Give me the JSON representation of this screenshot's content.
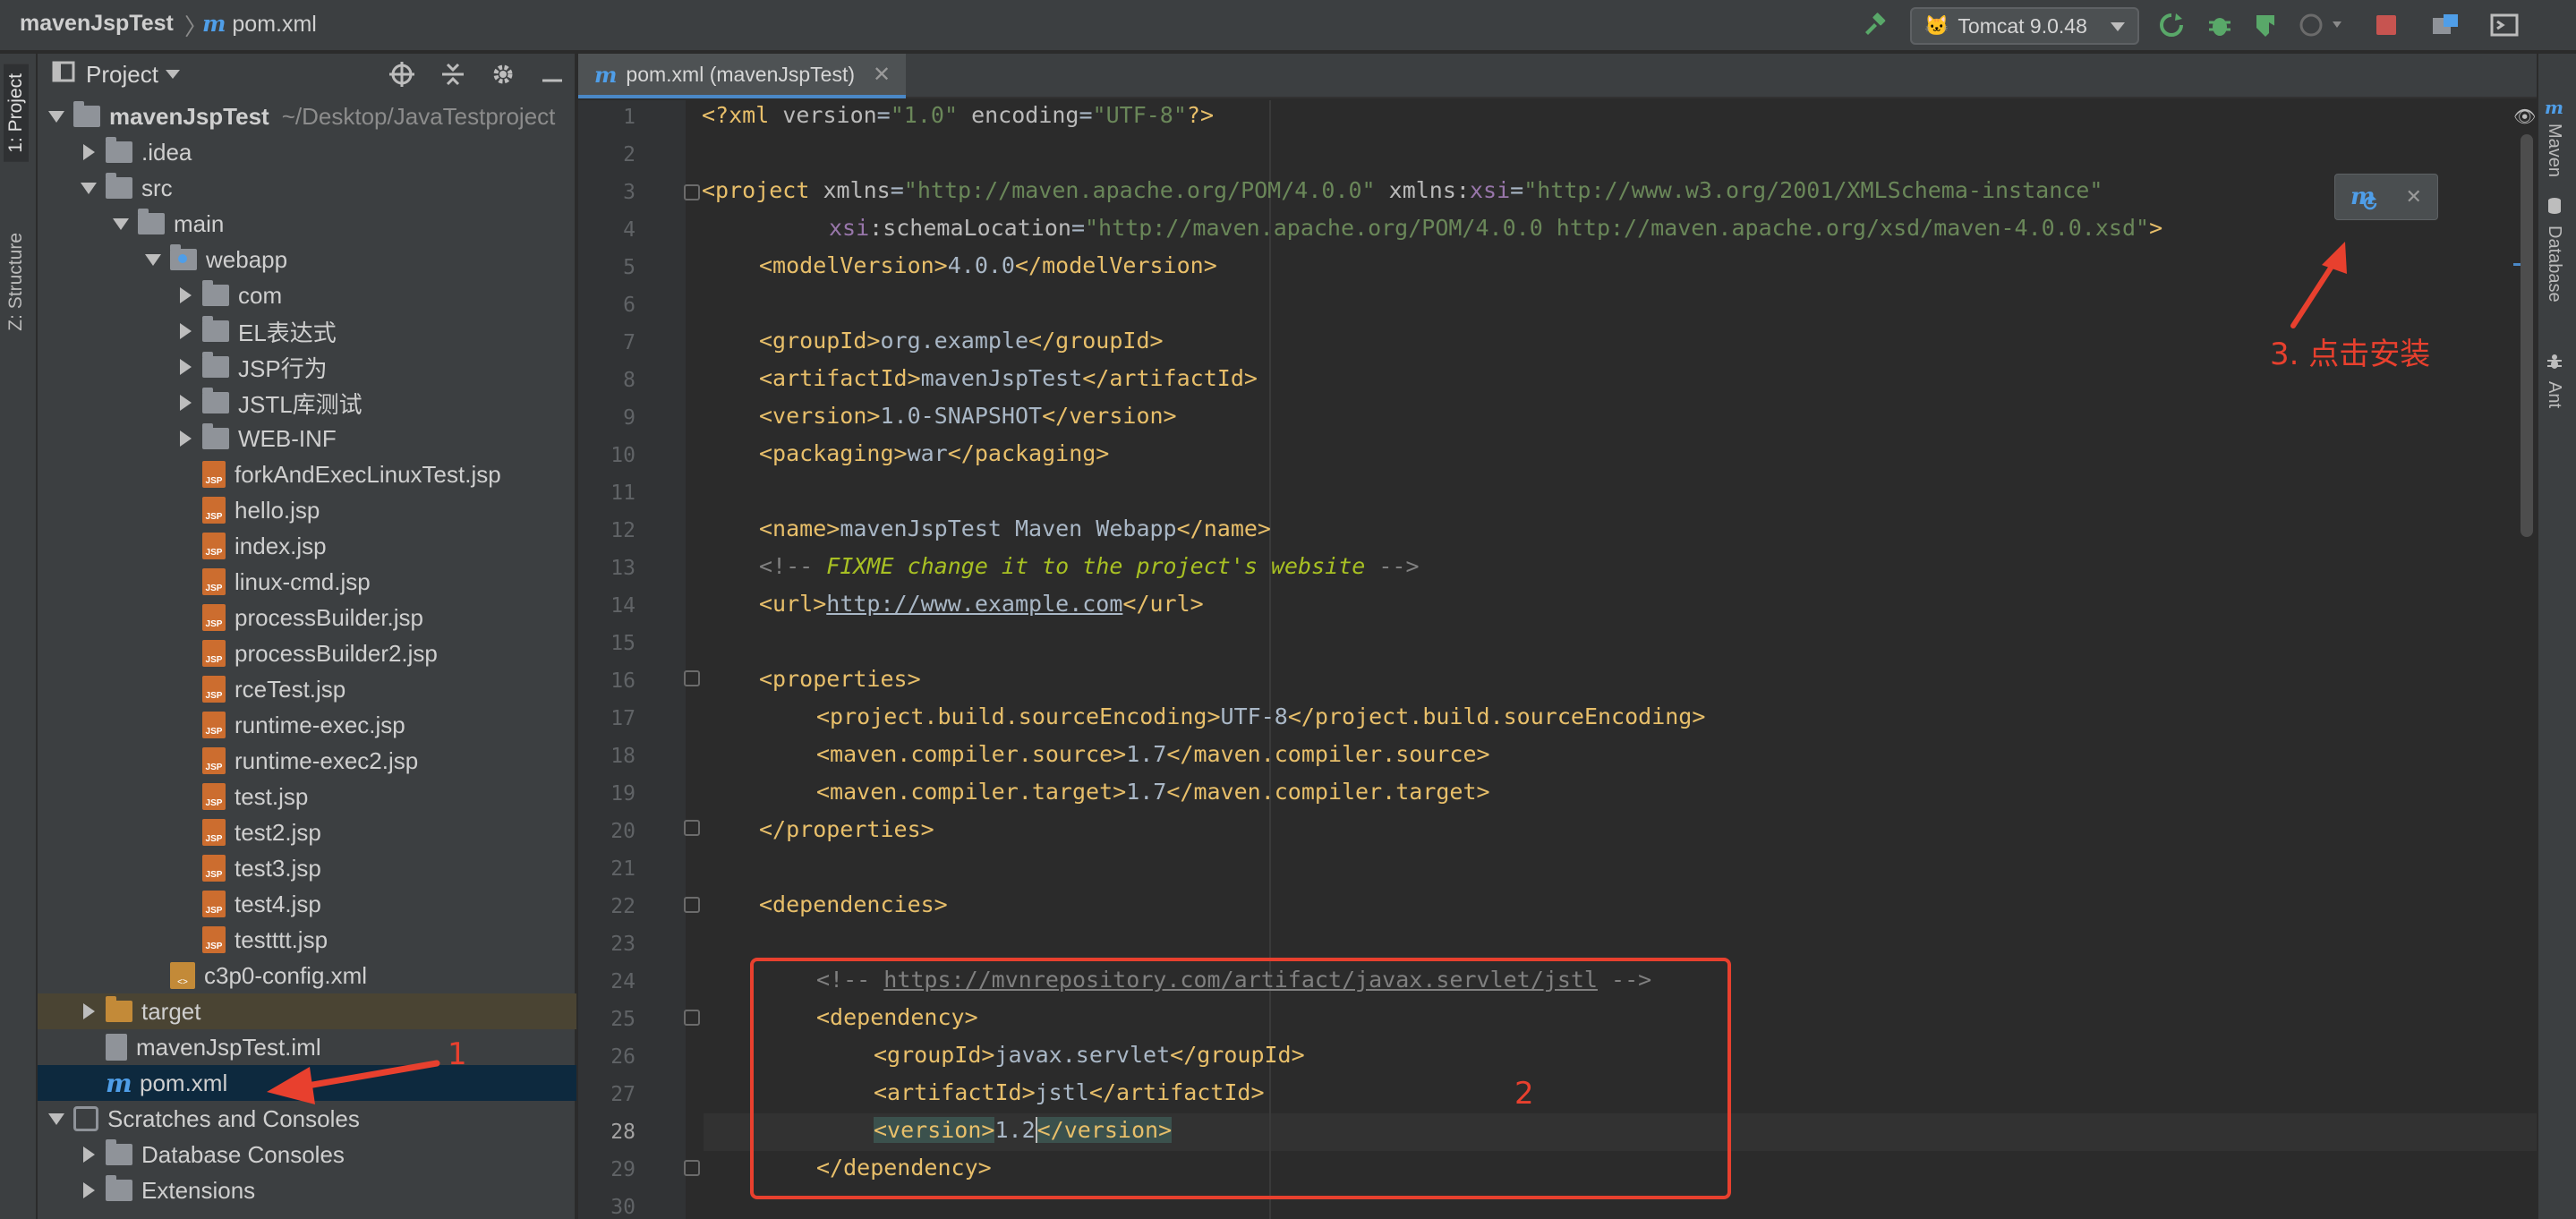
{
  "breadcrumb": {
    "project": "mavenJspTest",
    "file": "pom.xml"
  },
  "toolbar": {
    "run_config": "Tomcat 9.0.48"
  },
  "left_tabs": [
    "1: Project",
    "Z: Structure"
  ],
  "right_tabs": [
    "Maven",
    "Database",
    "Ant"
  ],
  "project_panel": {
    "title": "Project",
    "tree": [
      {
        "label": "mavenJspTest",
        "path": "~/Desktop/JavaTestproject",
        "level": 0,
        "icon": "folder",
        "expanded": true,
        "bold": true
      },
      {
        "label": ".idea",
        "level": 1,
        "icon": "folder",
        "expanded": false
      },
      {
        "label": "src",
        "level": 1,
        "icon": "folder",
        "expanded": true
      },
      {
        "label": "main",
        "level": 2,
        "icon": "folder",
        "expanded": true
      },
      {
        "label": "webapp",
        "level": 3,
        "icon": "web-folder",
        "expanded": true
      },
      {
        "label": "com",
        "level": 4,
        "icon": "folder",
        "expanded": false
      },
      {
        "label": "EL表达式",
        "level": 4,
        "icon": "folder",
        "expanded": false
      },
      {
        "label": "JSP行为",
        "level": 4,
        "icon": "folder",
        "expanded": false
      },
      {
        "label": "JSTL库测试",
        "level": 4,
        "icon": "folder",
        "expanded": false
      },
      {
        "label": "WEB-INF",
        "level": 4,
        "icon": "folder",
        "expanded": false
      },
      {
        "label": "forkAndExecLinuxTest.jsp",
        "level": 4,
        "icon": "jsp"
      },
      {
        "label": "hello.jsp",
        "level": 4,
        "icon": "jsp"
      },
      {
        "label": "index.jsp",
        "level": 4,
        "icon": "jsp"
      },
      {
        "label": "linux-cmd.jsp",
        "level": 4,
        "icon": "jsp"
      },
      {
        "label": "processBuilder.jsp",
        "level": 4,
        "icon": "jsp"
      },
      {
        "label": "processBuilder2.jsp",
        "level": 4,
        "icon": "jsp"
      },
      {
        "label": "rceTest.jsp",
        "level": 4,
        "icon": "jsp"
      },
      {
        "label": "runtime-exec.jsp",
        "level": 4,
        "icon": "jsp"
      },
      {
        "label": "runtime-exec2.jsp",
        "level": 4,
        "icon": "jsp"
      },
      {
        "label": "test.jsp",
        "level": 4,
        "icon": "jsp"
      },
      {
        "label": "test2.jsp",
        "level": 4,
        "icon": "jsp"
      },
      {
        "label": "test3.jsp",
        "level": 4,
        "icon": "jsp"
      },
      {
        "label": "test4.jsp",
        "level": 4,
        "icon": "jsp"
      },
      {
        "label": "testttt.jsp",
        "level": 4,
        "icon": "jsp"
      },
      {
        "label": "c3p0-config.xml",
        "level": 3,
        "icon": "xml"
      },
      {
        "label": "target",
        "level": 1,
        "icon": "orange-folder",
        "expanded": false,
        "highlight": true
      },
      {
        "label": "mavenJspTest.iml",
        "level": 1,
        "icon": "iml"
      },
      {
        "label": "pom.xml",
        "level": 1,
        "icon": "maven",
        "selected": true
      },
      {
        "label": "Scratches and Consoles",
        "level": 0,
        "icon": "scratch",
        "expanded": true
      },
      {
        "label": "Database Consoles",
        "level": 1,
        "icon": "folder",
        "expanded": false
      },
      {
        "label": "Extensions",
        "level": 1,
        "icon": "folder",
        "expanded": false
      }
    ]
  },
  "editor": {
    "tab_label": "pom.xml (mavenJspTest)",
    "current_line": 28,
    "line_numbers": [
      "1",
      "2",
      "3",
      "4",
      "5",
      "6",
      "7",
      "8",
      "9",
      "10",
      "11",
      "12",
      "13",
      "14",
      "15",
      "16",
      "17",
      "18",
      "19",
      "20",
      "21",
      "22",
      "23",
      "24",
      "25",
      "26",
      "27",
      "28",
      "29",
      "30"
    ],
    "code": {
      "l1": {
        "a": "<?xml ",
        "b": "version",
        "c": "=",
        "d": "\"1.0\"",
        "e": " ",
        "f": "encoding",
        "g": "=",
        "h": "\"UTF-8\"",
        "i": "?>"
      },
      "l3": {
        "a": "<project ",
        "b": "xmlns",
        "c": "=",
        "d": "\"http://maven.apache.org/POM/4.0.0\"",
        "e": " ",
        "f": "xmlns",
        "g": ":",
        "h": "xsi",
        "i": "=",
        "j": "\"http://www.w3.org/2001/XMLSchema-instance\""
      },
      "l4": {
        "a": "xsi",
        "b": ":schemaLocation",
        "c": "=",
        "d": "\"http://maven.apache.org/POM/4.0.0 http://maven.apache.org/xsd/maven-4.0.0.xsd\"",
        "e": ">"
      },
      "l5": {
        "a": "<modelVersion>",
        "b": "4.0.0",
        "c": "</modelVersion>"
      },
      "l7": {
        "a": "<groupId>",
        "b": "org.example",
        "c": "</groupId>"
      },
      "l8": {
        "a": "<artifactId>",
        "b": "mavenJspTest",
        "c": "</artifactId>"
      },
      "l9": {
        "a": "<version>",
        "b": "1.0-SNAPSHOT",
        "c": "</version>"
      },
      "l10": {
        "a": "<packaging>",
        "b": "war",
        "c": "</packaging>"
      },
      "l12": {
        "a": "<name>",
        "b": "mavenJspTest Maven Webapp",
        "c": "</name>"
      },
      "l13": {
        "a": "<!-- ",
        "b": "FIXME change it to the project's website",
        "c": " -->"
      },
      "l14": {
        "a": "<url>",
        "b": "http://www.example.com",
        "c": "</url>"
      },
      "l16": {
        "a": "<properties>"
      },
      "l17": {
        "a": "<project.build.sourceEncoding>",
        "b": "UTF-8",
        "c": "</project.build.sourceEncoding>"
      },
      "l18": {
        "a": "<maven.compiler.source>",
        "b": "1.7",
        "c": "</maven.compiler.source>"
      },
      "l19": {
        "a": "<maven.compiler.target>",
        "b": "1.7",
        "c": "</maven.compiler.target>"
      },
      "l20": {
        "a": "</properties>"
      },
      "l22": {
        "a": "<dependencies>"
      },
      "l24": {
        "a": "<!-- ",
        "b": "https://mvnrepository.com/artifact/javax.servlet/jstl",
        "c": " -->"
      },
      "l25": {
        "a": "<dependency>"
      },
      "l26": {
        "a": "<groupId>",
        "b": "javax.servlet",
        "c": "</groupId>"
      },
      "l27": {
        "a": "<artifactId>",
        "b": "jstl",
        "c": "</artifactId>"
      },
      "l28": {
        "a": "<version>",
        "b": "1.2",
        "c": "</version>"
      },
      "l29": {
        "a": "</dependency>"
      }
    }
  },
  "annotations": {
    "step1": "1",
    "step2": "2",
    "step3": "3. 点击安装"
  },
  "colors": {
    "annotation": "#e8402e",
    "selection": "#0d293e",
    "accent": "#4a88c7"
  }
}
